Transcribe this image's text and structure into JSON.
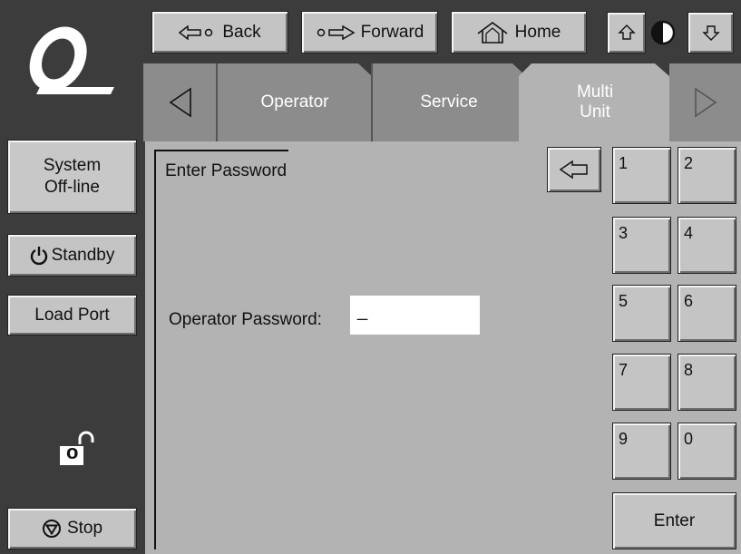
{
  "nav": {
    "back_label": "Back",
    "forward_label": "Forward",
    "home_label": "Home"
  },
  "tabs": [
    {
      "label": "Operator"
    },
    {
      "label": "Service"
    },
    {
      "label": "Multi\nUnit"
    }
  ],
  "sidebar": {
    "status_label": "System\nOff-line",
    "standby_label": "Standby",
    "load_port_label": "Load Port",
    "lock_letter": "o",
    "stop_label": "Stop"
  },
  "main": {
    "heading": "Enter Password",
    "password_label": "Operator Password:",
    "password_value": "_"
  },
  "keypad": {
    "keys": [
      "1",
      "2",
      "3",
      "4",
      "5",
      "6",
      "7",
      "8",
      "9",
      "0"
    ],
    "enter_label": "Enter"
  },
  "colors": {
    "background_dark": "#3c3c3c",
    "panel_gray": "#b3b3b3",
    "button_gray": "#c4c4c4",
    "active_tab": "#b3b3b3",
    "inactive_tab": "#8c8c8c"
  }
}
